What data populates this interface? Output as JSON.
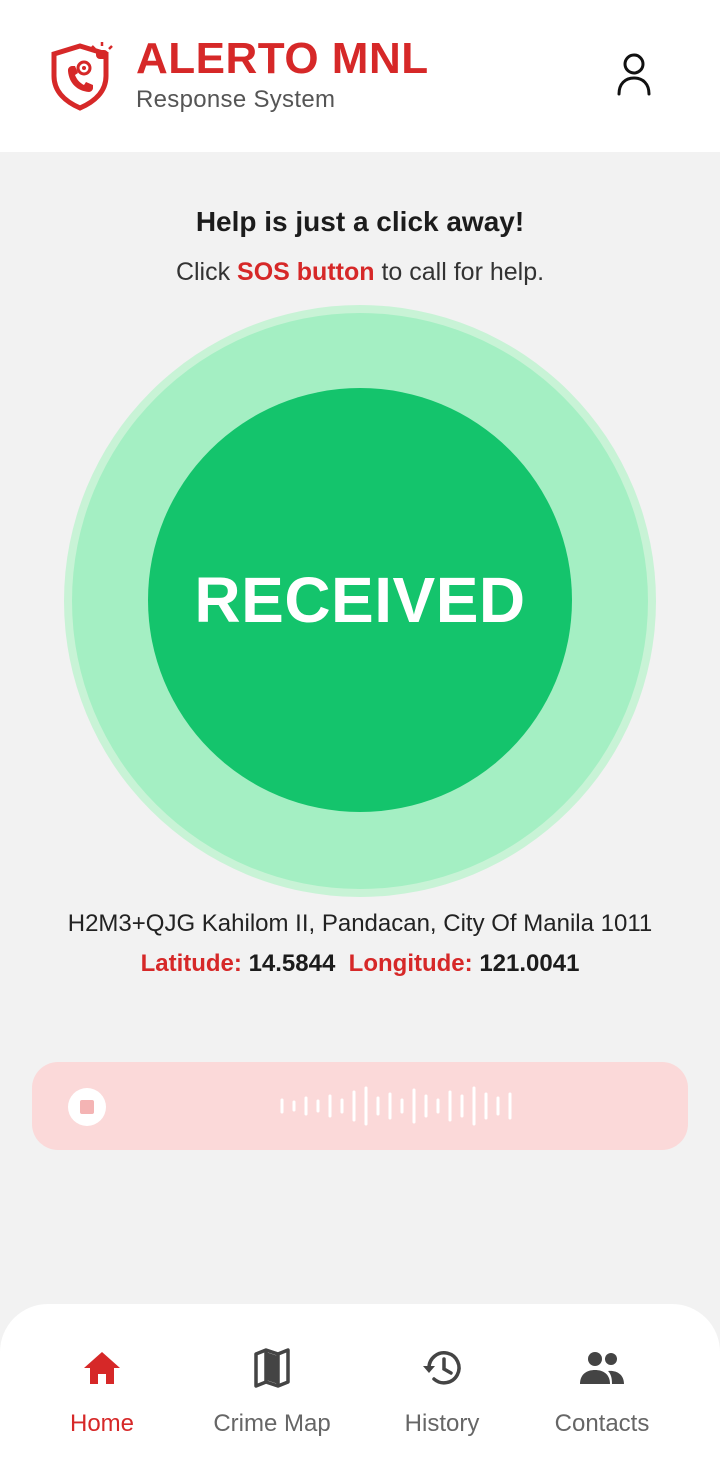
{
  "header": {
    "title": "ALERTO MNL",
    "subtitle": "Response System",
    "logo_icon": "shield-phone-alarm-icon",
    "profile_icon": "user-icon"
  },
  "intro": {
    "headline": "Help is just a click away!",
    "line_prefix": "Click ",
    "line_highlight": "SOS button",
    "line_suffix": " to call for help."
  },
  "sos": {
    "status_label": "RECEIVED",
    "color": "#14c46c"
  },
  "location": {
    "address": "H2M3+QJG Kahilom II, Pandacan, City Of Manila 1011",
    "latitude_label": "Latitude:",
    "latitude_value": "14.5844",
    "longitude_label": "Longitude:",
    "longitude_value": "121.0041"
  },
  "recorder": {
    "stop_icon": "stop-icon",
    "waveform_icon": "waveform-icon"
  },
  "bottom_nav": {
    "items": [
      {
        "label": "Home",
        "icon": "home-icon",
        "active": true
      },
      {
        "label": "Crime Map",
        "icon": "map-icon",
        "active": false
      },
      {
        "label": "History",
        "icon": "history-icon",
        "active": false
      },
      {
        "label": "Contacts",
        "icon": "contacts-icon",
        "active": false
      }
    ]
  },
  "colors": {
    "brand_red": "#d62828",
    "sos_green": "#14c46c",
    "recorder_bg": "#fbd9d9"
  }
}
